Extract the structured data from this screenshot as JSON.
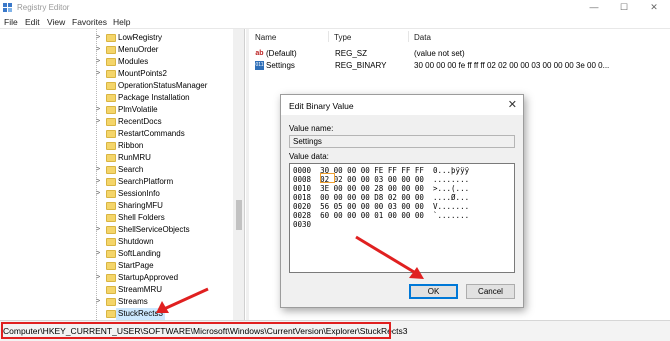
{
  "window": {
    "title": "Registry Editor",
    "minimize": "—",
    "maximize": "☐",
    "close": "✕"
  },
  "menu": [
    "File",
    "Edit",
    "View",
    "Favorites",
    "Help"
  ],
  "tree": {
    "items": [
      {
        "label": "LowRegistry",
        "expander": ">"
      },
      {
        "label": "MenuOrder",
        "expander": ">"
      },
      {
        "label": "Modules",
        "expander": ">"
      },
      {
        "label": "MountPoints2",
        "expander": ">"
      },
      {
        "label": "OperationStatusManager",
        "expander": ""
      },
      {
        "label": "Package Installation",
        "expander": ""
      },
      {
        "label": "PlmVolatile",
        "expander": ">"
      },
      {
        "label": "RecentDocs",
        "expander": ">"
      },
      {
        "label": "RestartCommands",
        "expander": ""
      },
      {
        "label": "Ribbon",
        "expander": ""
      },
      {
        "label": "RunMRU",
        "expander": ""
      },
      {
        "label": "Search",
        "expander": ">"
      },
      {
        "label": "SearchPlatform",
        "expander": ">"
      },
      {
        "label": "SessionInfo",
        "expander": ">"
      },
      {
        "label": "SharingMFU",
        "expander": ""
      },
      {
        "label": "Shell Folders",
        "expander": ""
      },
      {
        "label": "ShellServiceObjects",
        "expander": ">"
      },
      {
        "label": "Shutdown",
        "expander": ""
      },
      {
        "label": "SoftLanding",
        "expander": ">"
      },
      {
        "label": "StartPage",
        "expander": ""
      },
      {
        "label": "StartupApproved",
        "expander": ">"
      },
      {
        "label": "StreamMRU",
        "expander": ""
      },
      {
        "label": "Streams",
        "expander": ">"
      },
      {
        "label": "StuckRects3",
        "expander": "",
        "selected": true
      }
    ]
  },
  "list": {
    "headers": [
      "Name",
      "Type",
      "Data"
    ],
    "rows": [
      {
        "icon": "string-value-icon",
        "icon_glyph": "ab",
        "name": "(Default)",
        "type": "REG_SZ",
        "data": "(value not set)"
      },
      {
        "icon": "binary-value-icon",
        "icon_glyph": "011",
        "name": "Settings",
        "type": "REG_BINARY",
        "data": "30 00 00 00 fe ff ff ff 02 02 00 00 03 00 00 00 3e 00 0..."
      }
    ]
  },
  "dialog": {
    "title": "Edit Binary Value",
    "close": "✕",
    "value_name_label": "Value name:",
    "value_name": "Settings",
    "value_data_label": "Value data:",
    "hex_rows": [
      "0000  30 00 00 00 FE FF FF FF  0...þÿÿÿ",
      "0008  02 02 00 00 03 00 00 00  ........",
      "0010  3E 00 00 00 28 00 00 00  >...(...",
      "0018  00 00 00 00 D8 02 00 00  ....Ø...",
      "0020  56 05 00 00 00 03 00 00  V.......",
      "0028  60 00 00 00 01 00 00 00  `.......",
      "0030"
    ],
    "ok": "OK",
    "cancel": "Cancel"
  },
  "status": {
    "path": "Computer\\HKEY_CURRENT_USER\\SOFTWARE\\Microsoft\\Windows\\CurrentVersion\\Explorer\\StuckRects3"
  },
  "colors": {
    "annotation": "#e02020",
    "highlight": "#f0a030",
    "selection": "#cce8ff",
    "folder": "#f4d56a"
  }
}
